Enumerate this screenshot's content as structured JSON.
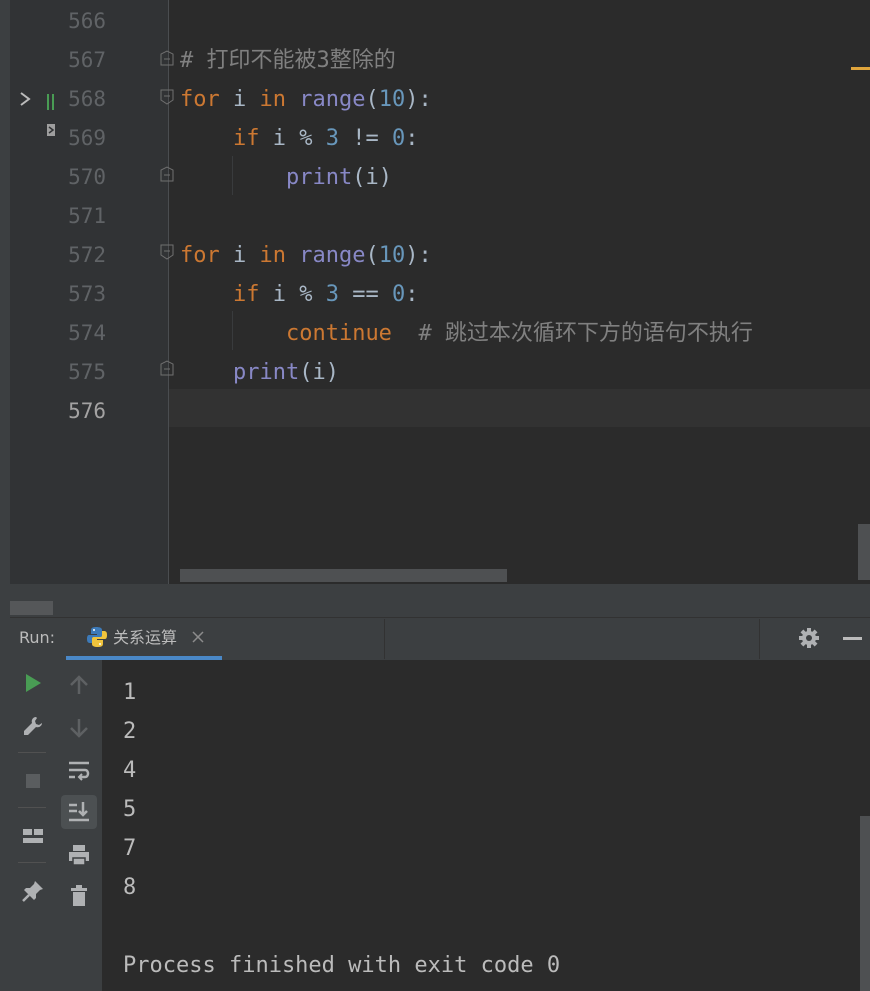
{
  "editor": {
    "lines": [
      {
        "n": "566",
        "tokens": []
      },
      {
        "n": "567",
        "tokens": [
          {
            "t": "# 打印不能被3整除的",
            "c": "cm"
          }
        ]
      },
      {
        "n": "568",
        "tokens": [
          {
            "t": "for",
            "c": "kw"
          },
          {
            "t": " i ",
            "c": "plain"
          },
          {
            "t": "in",
            "c": "kw"
          },
          {
            "t": " ",
            "c": "plain"
          },
          {
            "t": "range",
            "c": "fn"
          },
          {
            "t": "(",
            "c": "plain"
          },
          {
            "t": "10",
            "c": "num"
          },
          {
            "t": "):",
            "c": "plain"
          }
        ]
      },
      {
        "n": "569",
        "tokens": [
          {
            "t": "    ",
            "c": "plain"
          },
          {
            "t": "if",
            "c": "kw"
          },
          {
            "t": " i % ",
            "c": "plain"
          },
          {
            "t": "3",
            "c": "num"
          },
          {
            "t": " != ",
            "c": "plain"
          },
          {
            "t": "0",
            "c": "num"
          },
          {
            "t": ":",
            "c": "plain"
          }
        ]
      },
      {
        "n": "570",
        "tokens": [
          {
            "t": "        ",
            "c": "plain"
          },
          {
            "t": "print",
            "c": "fn"
          },
          {
            "t": "(i)",
            "c": "plain"
          }
        ]
      },
      {
        "n": "571",
        "tokens": []
      },
      {
        "n": "572",
        "tokens": [
          {
            "t": "for",
            "c": "kw"
          },
          {
            "t": " i ",
            "c": "plain"
          },
          {
            "t": "in",
            "c": "kw"
          },
          {
            "t": " ",
            "c": "plain"
          },
          {
            "t": "range",
            "c": "fn"
          },
          {
            "t": "(",
            "c": "plain"
          },
          {
            "t": "10",
            "c": "num"
          },
          {
            "t": "):",
            "c": "plain"
          }
        ]
      },
      {
        "n": "573",
        "tokens": [
          {
            "t": "    ",
            "c": "plain"
          },
          {
            "t": "if",
            "c": "kw"
          },
          {
            "t": " i % ",
            "c": "plain"
          },
          {
            "t": "3",
            "c": "num"
          },
          {
            "t": " == ",
            "c": "plain"
          },
          {
            "t": "0",
            "c": "num"
          },
          {
            "t": ":",
            "c": "plain"
          }
        ]
      },
      {
        "n": "574",
        "tokens": [
          {
            "t": "        ",
            "c": "plain"
          },
          {
            "t": "continue",
            "c": "kw"
          },
          {
            "t": "  ",
            "c": "plain"
          },
          {
            "t": "# 跳过本次循环下方的语句不执行",
            "c": "cm"
          }
        ]
      },
      {
        "n": "575",
        "tokens": [
          {
            "t": "    ",
            "c": "plain"
          },
          {
            "t": "print",
            "c": "fn"
          },
          {
            "t": "(i)",
            "c": "plain"
          }
        ]
      },
      {
        "n": "576",
        "tokens": [],
        "active": true
      }
    ]
  },
  "run_panel": {
    "label": "Run:",
    "tab_title": "关系运算",
    "output": [
      "1",
      "2",
      "4",
      "5",
      "7",
      "8",
      "",
      "Process finished with exit code 0"
    ]
  },
  "icons": {
    "run_tab": "python-icon",
    "tab_close": "close-icon",
    "settings": "gear-icon",
    "hide": "minimize-icon",
    "toolbar_left": [
      "rerun-icon",
      "wrench-icon",
      "stop-icon",
      "layout-icon",
      "pin-icon"
    ],
    "toolbar_right": [
      "up-arrow-icon",
      "down-arrow-icon",
      "soft-wrap-icon",
      "scroll-to-end-icon",
      "print-icon",
      "trash-icon"
    ]
  },
  "colors": {
    "keyword": "#cc7832",
    "builtin": "#8888c6",
    "number": "#6897bb",
    "comment": "#808080",
    "text": "#a9b7c6",
    "tab_underline": "#4a88c7",
    "run_green": "#499c54"
  }
}
